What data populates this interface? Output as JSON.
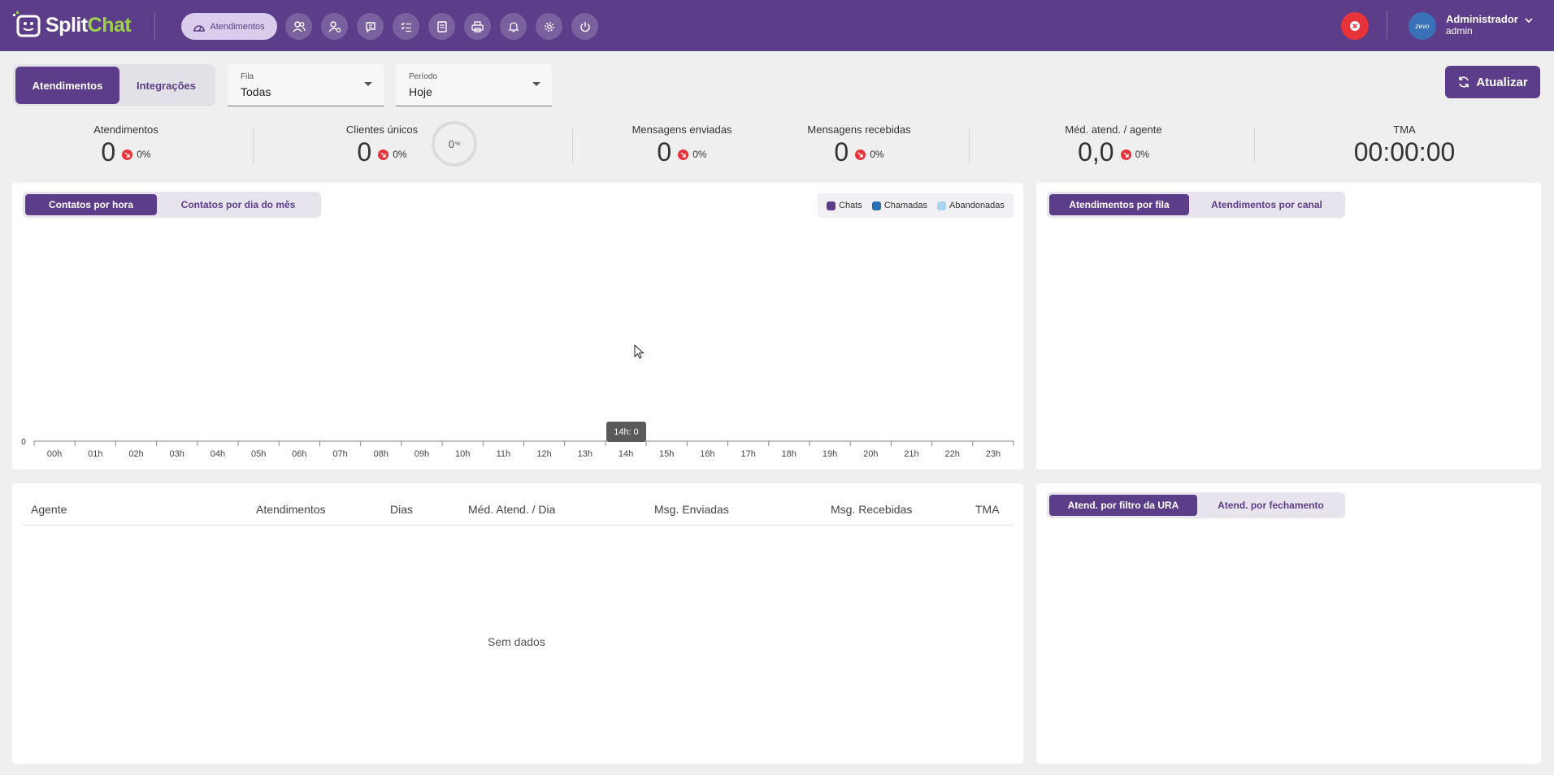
{
  "app": {
    "logo_part1": "Split",
    "logo_part2": "Chat"
  },
  "nav": {
    "active_label": "Atendimentos",
    "icons": [
      "contacts-icon",
      "user-settings-icon",
      "chat-icon",
      "checklist-icon",
      "report-icon",
      "print-icon",
      "bell-icon",
      "gear-icon",
      "power-icon"
    ]
  },
  "user": {
    "name": "Administrador",
    "role": "admin",
    "avatar_text": "zevo"
  },
  "toolbar": {
    "seg_active": "Atendimentos",
    "seg_other": "Integrações",
    "fila": {
      "label": "Fila",
      "value": "Todas"
    },
    "periodo": {
      "label": "Período",
      "value": "Hoje"
    },
    "refresh_label": "Atualizar"
  },
  "stats": [
    {
      "title": "Atendimentos",
      "value": "0",
      "pct": "0%"
    },
    {
      "title": "Clientes únicos",
      "value": "0",
      "pct": "0%"
    },
    {
      "title": "Mensagens enviadas",
      "value": "0",
      "pct": "0%"
    },
    {
      "title": "Mensagens recebidas",
      "value": "0",
      "pct": "0%"
    },
    {
      "title": "Méd. atend. / agente",
      "value": "0,0",
      "pct": "0%"
    },
    {
      "title": "TMA",
      "value": "00:00:00"
    }
  ],
  "ring": {
    "value": "0",
    "unit": "%"
  },
  "chart_card": {
    "tab_active": "Contatos por hora",
    "tab_other": "Contatos por dia do mês",
    "legend": [
      {
        "name": "Chats",
        "color": "#5c3d8a"
      },
      {
        "name": "Chamadas",
        "color": "#2a6fb5"
      },
      {
        "name": "Abandonadas",
        "color": "#a9d4f0"
      }
    ],
    "tooltip": "14h: 0"
  },
  "chart_data": {
    "type": "bar",
    "categories": [
      "00h",
      "01h",
      "02h",
      "03h",
      "04h",
      "05h",
      "06h",
      "07h",
      "08h",
      "09h",
      "10h",
      "11h",
      "12h",
      "13h",
      "14h",
      "15h",
      "16h",
      "17h",
      "18h",
      "19h",
      "20h",
      "21h",
      "22h",
      "23h"
    ],
    "series": [
      {
        "name": "Chats",
        "values": [
          0,
          0,
          0,
          0,
          0,
          0,
          0,
          0,
          0,
          0,
          0,
          0,
          0,
          0,
          0,
          0,
          0,
          0,
          0,
          0,
          0,
          0,
          0,
          0
        ]
      },
      {
        "name": "Chamadas",
        "values": [
          0,
          0,
          0,
          0,
          0,
          0,
          0,
          0,
          0,
          0,
          0,
          0,
          0,
          0,
          0,
          0,
          0,
          0,
          0,
          0,
          0,
          0,
          0,
          0
        ]
      },
      {
        "name": "Abandonadas",
        "values": [
          0,
          0,
          0,
          0,
          0,
          0,
          0,
          0,
          0,
          0,
          0,
          0,
          0,
          0,
          0,
          0,
          0,
          0,
          0,
          0,
          0,
          0,
          0,
          0
        ]
      }
    ],
    "y_tick": "0",
    "legend_position": "top-right"
  },
  "queue_card": {
    "tab_active": "Atendimentos por fila",
    "tab_other": "Atendimentos por canal"
  },
  "ura_card": {
    "tab_active": "Atend. por filtro da URA",
    "tab_other": "Atend. por fechamento"
  },
  "agent_table": {
    "columns": [
      "Agente",
      "Atendimentos",
      "Dias",
      "Méd. Atend. / Dia",
      "Msg. Enviadas",
      "Msg. Recebidas",
      "TMA"
    ],
    "empty_text": "Sem dados"
  }
}
